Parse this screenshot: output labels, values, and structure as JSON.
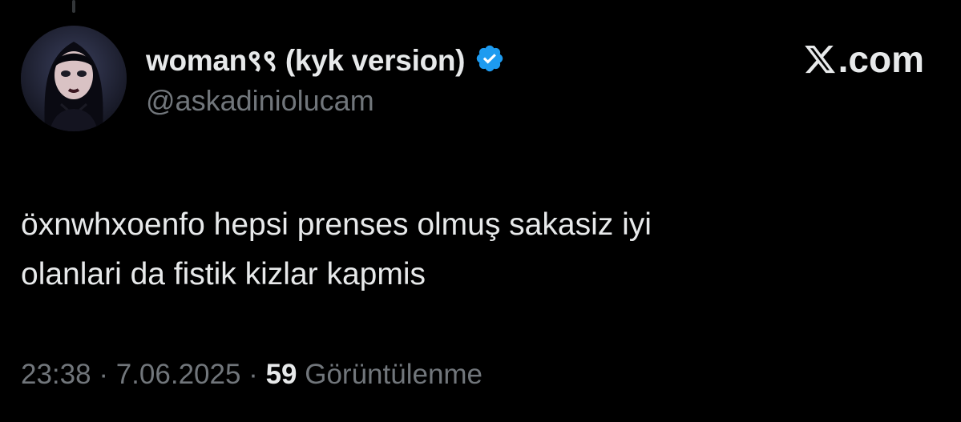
{
  "author": {
    "display_name": "woman९९ (kyk version)",
    "handle": "@askadiniolucam",
    "verified": true,
    "avatar_icon": "profile-avatar"
  },
  "brand": {
    "label": ".com",
    "icon": "x-logo-icon"
  },
  "tweet": {
    "text": "öxnwhxoenfo hepsi prenses olmuş sakasiz iyi\nolanlari da fistik kizlar kapmis"
  },
  "meta": {
    "time": "23:38",
    "separator": "·",
    "date": "7.06.2025",
    "views_count": "59",
    "views_label": "Görüntülenme"
  },
  "colors": {
    "background": "#000000",
    "primary_text": "#e7e9ea",
    "secondary_text": "#71767b",
    "verified_blue": "#1d9bf0"
  }
}
